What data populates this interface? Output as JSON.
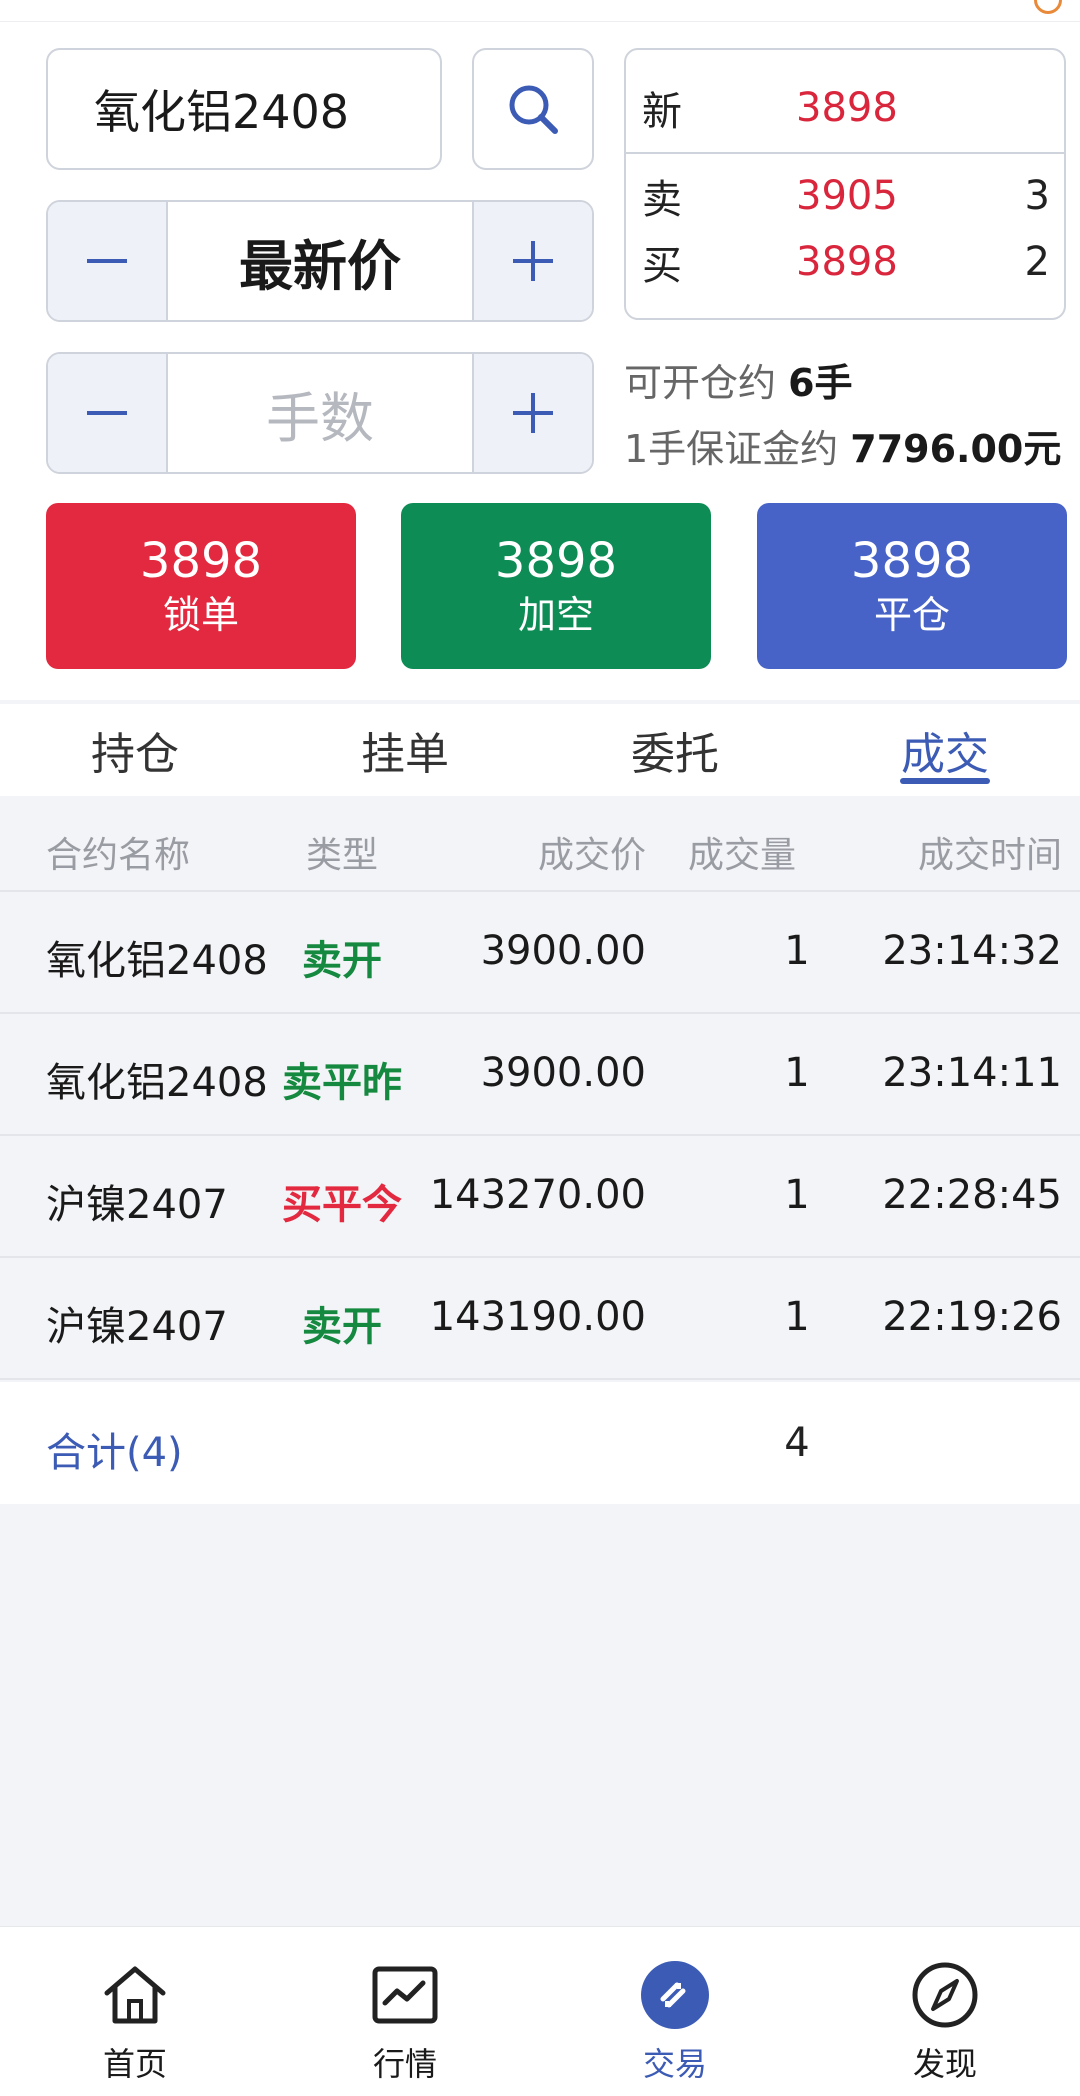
{
  "order_panel": {
    "symbol": "氧化铝2408",
    "price_mode": "最新价",
    "qty_placeholder": "手数"
  },
  "quote": {
    "last_label": "新",
    "last_price": "3898",
    "ask_label": "卖",
    "ask_price": "3905",
    "ask_vol": "3",
    "bid_label": "买",
    "bid_price": "3898",
    "bid_vol": "2"
  },
  "info": {
    "open_label": "可开仓约",
    "open_value": "6手",
    "margin_label": "1手保证金约",
    "margin_value": "7796.00元"
  },
  "actions": [
    {
      "price": "3898",
      "label": "锁单",
      "color": "#e3293f"
    },
    {
      "price": "3898",
      "label": "加空",
      "color": "#0e8c55"
    },
    {
      "price": "3898",
      "label": "平仓",
      "color": "#4763c7"
    }
  ],
  "tabs": [
    {
      "label": "持仓"
    },
    {
      "label": "挂单"
    },
    {
      "label": "委托"
    },
    {
      "label": "成交",
      "active": true
    }
  ],
  "trades": {
    "headers": {
      "name": "合约名称",
      "type": "类型",
      "price": "成交价",
      "volume": "成交量",
      "time": "成交时间"
    },
    "rows": [
      {
        "name": "氧化铝2408",
        "type": "卖开",
        "type_color": "#15893f",
        "price": "3900.00",
        "volume": "1",
        "time": "23:14:32"
      },
      {
        "name": "氧化铝2408",
        "type": "卖平昨",
        "type_color": "#15893f",
        "price": "3900.00",
        "volume": "1",
        "time": "23:14:11"
      },
      {
        "name": "沪镍2407",
        "type": "买平今",
        "type_color": "#e3293f",
        "price": "143270.00",
        "volume": "1",
        "time": "22:28:45"
      },
      {
        "name": "沪镍2407",
        "type": "卖开",
        "type_color": "#15893f",
        "price": "143190.00",
        "volume": "1",
        "time": "22:19:26"
      }
    ],
    "summary": {
      "label": "合计(4)",
      "volume": "4"
    }
  },
  "bottom_nav": [
    {
      "label": "首页",
      "icon": "home-icon"
    },
    {
      "label": "行情",
      "icon": "chart-icon"
    },
    {
      "label": "交易",
      "icon": "trade-icon",
      "active": true
    },
    {
      "label": "发现",
      "icon": "compass-icon"
    }
  ],
  "colors": {
    "accent": "#3c5bb5",
    "up_red": "#d9263c",
    "down_green": "#15893f"
  }
}
